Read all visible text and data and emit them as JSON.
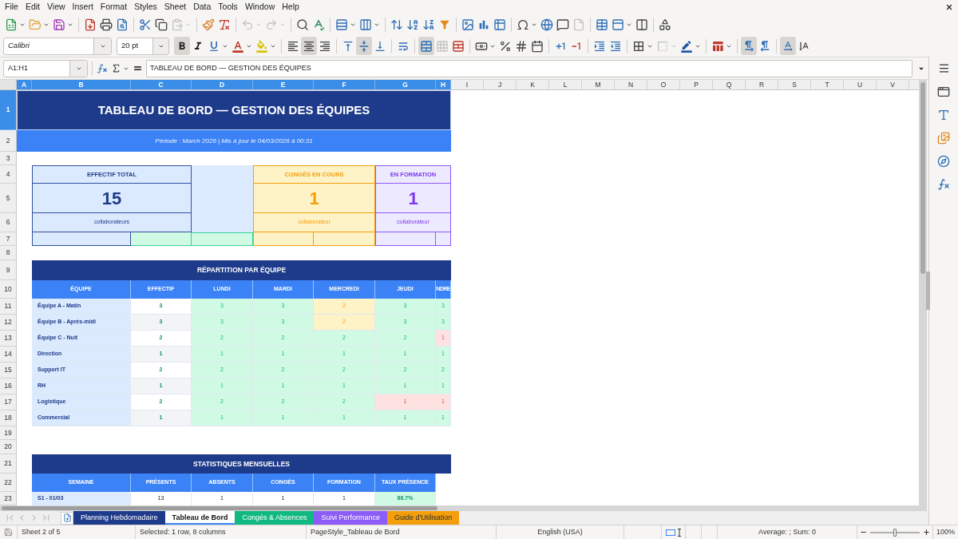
{
  "menu": [
    "File",
    "Edit",
    "View",
    "Insert",
    "Format",
    "Styles",
    "Sheet",
    "Data",
    "Tools",
    "Window",
    "Help"
  ],
  "standard_toolbar": [
    [
      {
        "kind": "new",
        "dropdown": true,
        "disabled": false
      },
      {
        "kind": "open",
        "dropdown": true,
        "disabled": false
      },
      {
        "kind": "save",
        "dropdown": true,
        "disabled": false
      }
    ],
    [
      {
        "kind": "pdf",
        "disabled": false
      },
      {
        "kind": "print",
        "disabled": false
      },
      {
        "kind": "preview",
        "disabled": false
      }
    ],
    [
      {
        "kind": "cut",
        "disabled": false
      },
      {
        "kind": "copy",
        "disabled": false
      },
      {
        "kind": "paste",
        "dropdown": true,
        "disabled": true
      }
    ],
    [
      {
        "kind": "clone",
        "disabled": false
      },
      {
        "kind": "clear",
        "disabled": false
      }
    ],
    [
      {
        "kind": "undo",
        "dropdown": true,
        "disabled": true
      },
      {
        "kind": "redo",
        "dropdown": true,
        "disabled": true
      }
    ],
    [
      {
        "kind": "find",
        "disabled": false
      },
      {
        "kind": "spelling",
        "disabled": false
      }
    ],
    [
      {
        "kind": "rows",
        "dropdown": true,
        "disabled": false
      },
      {
        "kind": "columns",
        "dropdown": true,
        "disabled": false
      }
    ],
    [
      {
        "kind": "sort",
        "disabled": false
      },
      {
        "kind": "ascending",
        "disabled": false
      },
      {
        "kind": "descending",
        "disabled": false
      },
      {
        "kind": "filter",
        "disabled": false
      }
    ],
    [
      {
        "kind": "image",
        "disabled": false
      },
      {
        "kind": "chart",
        "disabled": false
      },
      {
        "kind": "pivot",
        "disabled": false
      }
    ],
    [
      {
        "kind": "symbol",
        "dropdown": true,
        "disabled": false
      },
      {
        "kind": "hyperlink",
        "disabled": false
      },
      {
        "kind": "comment",
        "disabled": false
      },
      {
        "kind": "headers",
        "disabled": true
      }
    ],
    [
      {
        "kind": "printarea",
        "disabled": false
      },
      {
        "kind": "freeze",
        "dropdown": true,
        "disabled": false
      },
      {
        "kind": "split",
        "disabled": false
      }
    ],
    [
      {
        "kind": "shapes",
        "disabled": false
      }
    ]
  ],
  "formatting_toolbar": {
    "font_name": "Calibri",
    "font_size": "20 pt",
    "groups": [
      [
        {
          "kind": "bold",
          "pressed": true,
          "disabled": false
        },
        {
          "kind": "italic",
          "pressed": false,
          "disabled": false
        },
        {
          "kind": "underline",
          "dropdown": true,
          "pressed": false,
          "disabled": false
        },
        {
          "kind": "fontcolor",
          "dropdown": true,
          "pressed": false,
          "disabled": false
        },
        {
          "kind": "highlight",
          "dropdown": true,
          "pressed": false,
          "disabled": false
        }
      ],
      [
        {
          "kind": "left",
          "pressed": false,
          "disabled": false
        },
        {
          "kind": "center",
          "pressed": true,
          "disabled": false
        },
        {
          "kind": "right",
          "pressed": false,
          "disabled": false
        }
      ],
      [
        {
          "kind": "top",
          "pressed": false,
          "disabled": false
        },
        {
          "kind": "middle",
          "pressed": true,
          "disabled": false
        },
        {
          "kind": "bottom",
          "pressed": false,
          "disabled": false
        }
      ],
      [
        {
          "kind": "wrap",
          "pressed": false,
          "disabled": false
        }
      ],
      [
        {
          "kind": "mergecenter",
          "pressed": true,
          "disabled": false
        },
        {
          "kind": "merge",
          "pressed": false,
          "disabled": true
        },
        {
          "kind": "unmerge",
          "pressed": false,
          "disabled": false
        }
      ],
      [
        {
          "kind": "currency",
          "dropdown": true,
          "pressed": false,
          "disabled": false
        },
        {
          "kind": "percent",
          "pressed": false,
          "disabled": false
        },
        {
          "kind": "number",
          "pressed": false,
          "disabled": false
        },
        {
          "kind": "date",
          "pressed": false,
          "disabled": false
        }
      ],
      [
        {
          "kind": "adddecimal",
          "pressed": false,
          "disabled": false
        },
        {
          "kind": "deldecimal",
          "pressed": false,
          "disabled": false
        }
      ],
      [
        {
          "kind": "indent",
          "pressed": false,
          "disabled": false
        },
        {
          "kind": "outdent",
          "pressed": false,
          "disabled": false
        }
      ],
      [
        {
          "kind": "borders",
          "dropdown": true,
          "pressed": false,
          "disabled": false
        },
        {
          "kind": "borderstyle",
          "dropdown": true,
          "pressed": false,
          "disabled": true
        },
        {
          "kind": "bordercolor",
          "dropdown": true,
          "pressed": false,
          "disabled": false
        }
      ],
      [
        {
          "kind": "conditional",
          "dropdown": true,
          "pressed": false,
          "disabled": false
        }
      ],
      [
        {
          "kind": "ltr",
          "pressed": true,
          "disabled": false
        },
        {
          "kind": "rtl",
          "pressed": false,
          "disabled": false
        }
      ],
      [
        {
          "kind": "horizontal",
          "pressed": true,
          "disabled": false
        },
        {
          "kind": "vertical",
          "pressed": false,
          "disabled": false
        }
      ]
    ]
  },
  "formula_bar": {
    "cell_reference": "A1:H1",
    "content": "TABLEAU DE BORD — GESTION DES ÉQUIPES"
  },
  "sidebar": [
    {
      "kind": "properties"
    },
    {
      "kind": "styles"
    },
    {
      "kind": "gallery"
    },
    {
      "kind": "navigator"
    },
    {
      "kind": "functions"
    }
  ],
  "sheet": {
    "columns": [
      {
        "label": "A",
        "selected": true
      },
      {
        "label": "B",
        "selected": true
      },
      {
        "label": "C",
        "selected": true
      },
      {
        "label": "D",
        "selected": true
      },
      {
        "label": "E",
        "selected": true
      },
      {
        "label": "F",
        "selected": true
      },
      {
        "label": "G",
        "selected": true
      },
      {
        "label": "H",
        "selected": true
      },
      {
        "label": "I",
        "selected": false
      },
      {
        "label": "J",
        "selected": false
      },
      {
        "label": "K",
        "selected": false
      },
      {
        "label": "L",
        "selected": false
      },
      {
        "label": "M",
        "selected": false
      },
      {
        "label": "N",
        "selected": false
      },
      {
        "label": "O",
        "selected": false
      },
      {
        "label": "P",
        "selected": false
      },
      {
        "label": "Q",
        "selected": false
      },
      {
        "label": "R",
        "selected": false
      },
      {
        "label": "S",
        "selected": false
      },
      {
        "label": "T",
        "selected": false
      },
      {
        "label": "U",
        "selected": false
      },
      {
        "label": "V",
        "selected": false
      }
    ],
    "rows": [
      {
        "label": "1",
        "selected": true
      },
      {
        "label": "2",
        "selected": false
      },
      {
        "label": "3",
        "selected": false
      },
      {
        "label": "4",
        "selected": false
      },
      {
        "label": "5",
        "selected": false
      },
      {
        "label": "6",
        "selected": false
      },
      {
        "label": "7",
        "selected": false
      },
      {
        "label": "8",
        "selected": false
      },
      {
        "label": "9",
        "selected": false
      },
      {
        "label": "10",
        "selected": false
      },
      {
        "label": "11",
        "selected": false
      },
      {
        "label": "12",
        "selected": false
      },
      {
        "label": "13",
        "selected": false
      },
      {
        "label": "14",
        "selected": false
      },
      {
        "label": "15",
        "selected": false
      },
      {
        "label": "16",
        "selected": false
      },
      {
        "label": "17",
        "selected": false
      },
      {
        "label": "18",
        "selected": false
      },
      {
        "label": "19",
        "selected": false
      },
      {
        "label": "20",
        "selected": false
      },
      {
        "label": "21",
        "selected": false
      },
      {
        "label": "22",
        "selected": false
      },
      {
        "label": "23",
        "selected": false
      }
    ],
    "title": "TABLEAU DE BORD — GESTION DES ÉQUIPES",
    "subtitle": "Période : March 2026 | Mis à jour le 04/03/2026 à 00:31",
    "kpis": [
      {
        "kind": "total",
        "label": "EFFECTIF TOTAL",
        "value": "15",
        "unit": "collaborateurs"
      },
      {
        "kind": "leave",
        "label": "CONGÉS EN COURS",
        "value": "1",
        "unit": "collaborateur"
      },
      {
        "kind": "training",
        "label": "EN FORMATION",
        "value": "1",
        "unit": "collaborateur"
      }
    ],
    "team_table": {
      "title": "RÉPARTITION PAR ÉQUIPE",
      "columns": [
        "ÉQUIPE",
        "EFFECTIF",
        "LUNDI",
        "MARDI",
        "MERCREDI",
        "JEUDI",
        "NDRE"
      ],
      "rows": [
        {
          "team": "Équipe A - Matin",
          "headcount": "3",
          "days": [
            {
              "value": "3",
              "kind": "full"
            },
            {
              "value": "3",
              "kind": "full"
            },
            {
              "value": "2",
              "kind": "partial"
            },
            {
              "value": "3",
              "kind": "full"
            },
            {
              "value": "3",
              "kind": "full"
            }
          ]
        },
        {
          "team": "Équipe B - Après-midi",
          "headcount": "3",
          "days": [
            {
              "value": "3",
              "kind": "full"
            },
            {
              "value": "3",
              "kind": "full"
            },
            {
              "value": "2",
              "kind": "partial"
            },
            {
              "value": "3",
              "kind": "full"
            },
            {
              "value": "3",
              "kind": "full"
            }
          ]
        },
        {
          "team": "Équipe C - Nuit",
          "headcount": "2",
          "days": [
            {
              "value": "2",
              "kind": "full"
            },
            {
              "value": "2",
              "kind": "full"
            },
            {
              "value": "2",
              "kind": "full"
            },
            {
              "value": "2",
              "kind": "full"
            },
            {
              "value": "1",
              "kind": "low"
            }
          ]
        },
        {
          "team": "Direction",
          "headcount": "1",
          "days": [
            {
              "value": "1",
              "kind": "full"
            },
            {
              "value": "1",
              "kind": "full"
            },
            {
              "value": "1",
              "kind": "full"
            },
            {
              "value": "1",
              "kind": "full"
            },
            {
              "value": "1",
              "kind": "full"
            }
          ]
        },
        {
          "team": "Support IT",
          "headcount": "2",
          "days": [
            {
              "value": "2",
              "kind": "full"
            },
            {
              "value": "2",
              "kind": "full"
            },
            {
              "value": "2",
              "kind": "full"
            },
            {
              "value": "2",
              "kind": "full"
            },
            {
              "value": "2",
              "kind": "full"
            }
          ]
        },
        {
          "team": "RH",
          "headcount": "1",
          "days": [
            {
              "value": "1",
              "kind": "full"
            },
            {
              "value": "1",
              "kind": "full"
            },
            {
              "value": "1",
              "kind": "full"
            },
            {
              "value": "1",
              "kind": "full"
            },
            {
              "value": "1",
              "kind": "full"
            }
          ]
        },
        {
          "team": "Logistique",
          "headcount": "2",
          "days": [
            {
              "value": "2",
              "kind": "full"
            },
            {
              "value": "2",
              "kind": "full"
            },
            {
              "value": "2",
              "kind": "full"
            },
            {
              "value": "1",
              "kind": "low"
            },
            {
              "value": "1",
              "kind": "low"
            }
          ]
        },
        {
          "team": "Commercial",
          "headcount": "1",
          "days": [
            {
              "value": "1",
              "kind": "full"
            },
            {
              "value": "1",
              "kind": "full"
            },
            {
              "value": "1",
              "kind": "full"
            },
            {
              "value": "1",
              "kind": "full"
            },
            {
              "value": "1",
              "kind": "full"
            }
          ]
        }
      ]
    },
    "stats_table": {
      "title": "STATISTIQUES MENSUELLES",
      "columns": [
        "SEMAINE",
        "PRÉSENTS",
        "ABSENTS",
        "CONGÉS",
        "FORMATION",
        "TAUX PRÉSENCE"
      ],
      "rows": [
        [
          "S1 - 01/03",
          "13",
          "1",
          "1",
          "1",
          "86.7%"
        ]
      ]
    }
  },
  "sheet_tabs": {
    "navigation": [
      {
        "kind": "first",
        "disabled": true
      },
      {
        "kind": "previous",
        "disabled": true
      },
      {
        "kind": "next",
        "disabled": true
      },
      {
        "kind": "last",
        "disabled": true
      }
    ],
    "tabs": [
      {
        "label": "Planning Hebdomadaire",
        "color": "#1e3a8a",
        "selected": false
      },
      {
        "label": "Tableau de Bord",
        "color": "#3b82f6",
        "selected": true
      },
      {
        "label": "Congés & Absences",
        "color": "#10b981",
        "selected": false
      },
      {
        "label": "Suivi Performance",
        "color": "#8b5cf6",
        "selected": false
      },
      {
        "label": "Guide d'Utilisation",
        "color": "#f59e0b",
        "selected": false
      }
    ]
  },
  "status_bar": {
    "sheet": "Sheet 2 of 5",
    "selection": "Selected: 1 row, 8 columns",
    "page_style": "PageStyle_Tableau de Bord",
    "language": "English (USA)",
    "summary": "Average: ; Sum: 0",
    "zoom": {
      "level": 0.5,
      "reading": "100%"
    }
  }
}
